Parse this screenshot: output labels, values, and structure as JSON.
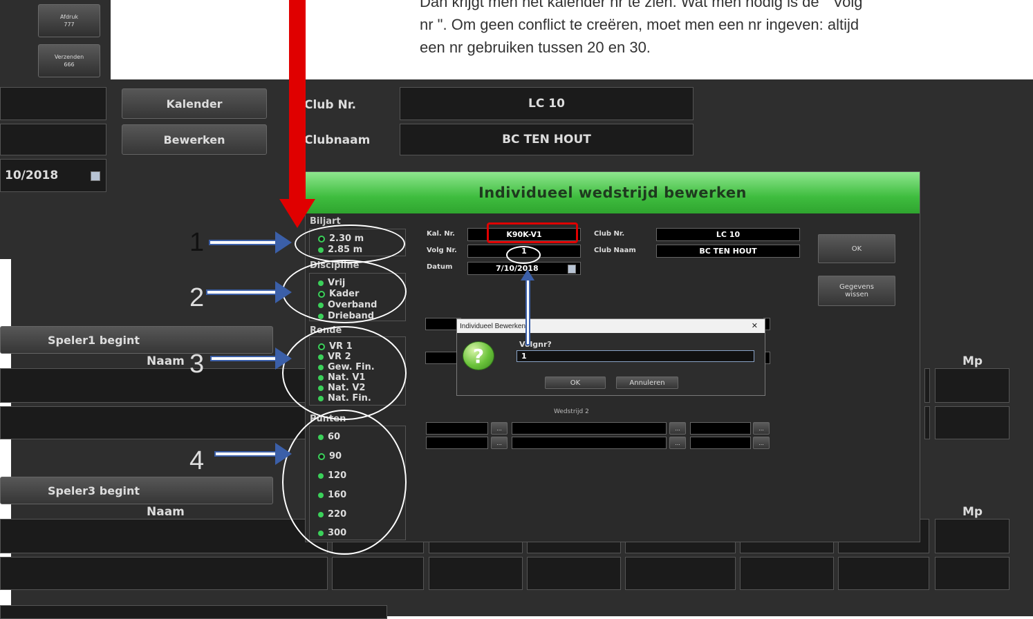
{
  "caption": {
    "line1": "Dan krijgt men het kalender nr te zien. Wat men nodig is de \" Volg",
    "line2": "nr \". Om geen conflict te creëren, moet men een nr ingeven: altijd",
    "line3": "een nr gebruiken tussen 20 en 30."
  },
  "top_buttons": {
    "afdruk": {
      "label": "Afdruk",
      "code": "777"
    },
    "verzenden": {
      "label": "Verzenden",
      "code": "666"
    }
  },
  "main": {
    "kalender_label": "Kalender",
    "bewerken_label": "Bewerken",
    "club_nr_label": "Club Nr.",
    "club_nr_value": "LC 10",
    "clubnaam_label": "Clubnaam",
    "clubnaam_value": "BC TEN HOUT",
    "date_value": "10/2018",
    "speler1_label": "Speler1 begint",
    "speler3_label": "Speler3 begint",
    "naam_label": "Naam",
    "mp_label": "Mp"
  },
  "dialog": {
    "title": "Individueel wedstrijd bewerken",
    "biljart": {
      "label": "Biljart",
      "options": [
        "2.30 m",
        "2.85 m"
      ],
      "selected": "2.30 m"
    },
    "discipline": {
      "label": "Discipline",
      "options": [
        "Vrij",
        "Kader",
        "Overband",
        "Drieband"
      ],
      "selected": "Kader"
    },
    "ronde": {
      "label": "Ronde",
      "options": [
        "VR 1",
        "VR 2",
        "Gew. Fin.",
        "Nat. V1",
        "Nat. V2",
        "Nat. Fin."
      ],
      "selected": "VR 1"
    },
    "punten": {
      "label": "Punten",
      "options": [
        "60",
        "90",
        "120",
        "160",
        "220",
        "300"
      ],
      "selected": "90"
    },
    "kal_nr_label": "Kal. Nr.",
    "kal_nr_value": "K90K-V1",
    "volg_nr_label": "Volg Nr.",
    "volg_nr_value": "1",
    "datum_label": "Datum",
    "datum_value": "7/10/2018",
    "club_nr_label": "Club Nr.",
    "club_nr_value": "LC 10",
    "club_naam_label": "Club Naam",
    "club_naam_value": "BC TEN HOUT",
    "ok_label": "OK",
    "gegevens_label_1": "Gegevens",
    "gegevens_label_2": "wissen",
    "wedstrijd2_label": "Wedstrijd 2",
    "dots": "..."
  },
  "message_box": {
    "title": "Individueel Bewerken",
    "close": "✕",
    "question": "Volgnr?",
    "input_value": "1",
    "ok_label": "OK",
    "cancel_label": "Annuleren"
  },
  "annotations": [
    "1",
    "2",
    "3",
    "4"
  ],
  "colors": {
    "accent_green": "#3fbd3f",
    "highlight_red": "#e00000",
    "arrow_blue": "#3b5fa8"
  }
}
